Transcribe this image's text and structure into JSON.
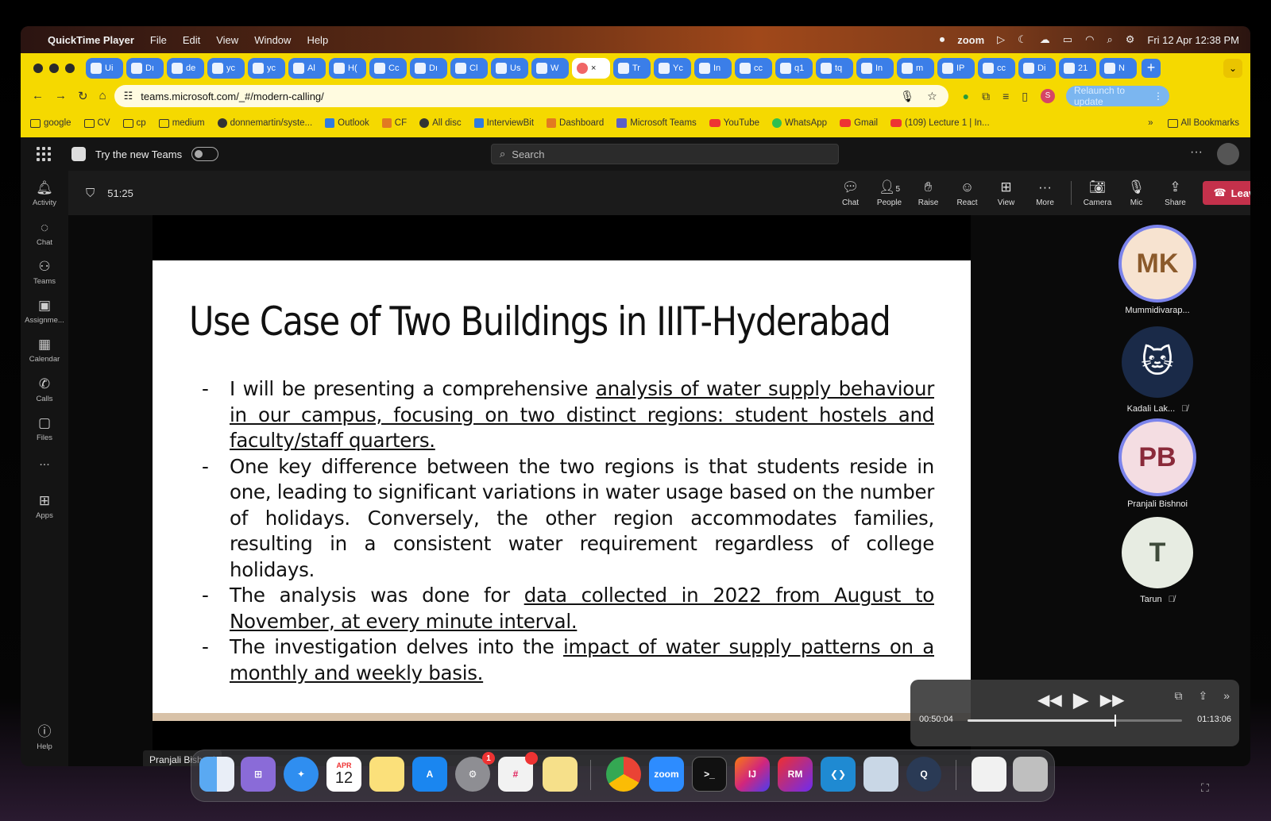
{
  "menubar": {
    "app": "QuickTime Player",
    "items": [
      "File",
      "Edit",
      "View",
      "Window",
      "Help"
    ],
    "zoom": "zoom",
    "datetime": "Fri 12 Apr 12:38 PM"
  },
  "browser": {
    "tabs": [
      "Ui",
      "Dı",
      "de",
      "yc",
      "yc",
      "Al",
      "H(",
      "Cc",
      "Dı",
      "Cl",
      "Us",
      "W",
      "",
      "Tr",
      "Yc",
      "In",
      "cc",
      "q1",
      "tq",
      "In",
      "m",
      "IP",
      "cc",
      "Di",
      "21",
      "N"
    ],
    "url": "teams.microsoft.com/_#/modern-calling/",
    "relaunch": "Relaunch to update",
    "profile_initial": "S",
    "bookmarks": [
      "google",
      "CV",
      "cp",
      "medium",
      "donnemartin/syste...",
      "Outlook",
      "CF",
      "All disc",
      "InterviewBit",
      "Dashboard",
      "Microsoft Teams",
      "YouTube",
      "WhatsApp",
      "Gmail",
      "(109) Lecture 1 | In..."
    ],
    "all_bookmarks": "All Bookmarks",
    "more": "»"
  },
  "teams": {
    "try_new": "Try the new Teams",
    "search_placeholder": "Search",
    "rail": [
      "Activity",
      "Chat",
      "Teams",
      "Assignme...",
      "Calendar",
      "Calls",
      "Files",
      "...",
      "Apps",
      "Help"
    ],
    "timer": "51:25",
    "toolbar": {
      "chat": "Chat",
      "people": "People",
      "people_count": "5",
      "raise": "Raise",
      "react": "React",
      "view": "View",
      "more": "More",
      "camera": "Camera",
      "mic": "Mic",
      "share": "Share",
      "leave": "Leave"
    },
    "speaker_tag": "Pranjali Bishnoi",
    "participants": [
      {
        "initials": "MK",
        "name": "Mummidivarap...",
        "color": "#f7e3d0",
        "text": "#8b5a2b"
      },
      {
        "initials": "",
        "name": "Kadali Lak...",
        "color": "#1a2a48",
        "text": "#fff"
      },
      {
        "initials": "PB",
        "name": "Pranjali Bishnoi",
        "color": "#f4dde2",
        "text": "#8a2a3a"
      },
      {
        "initials": "T",
        "name": "Tarun",
        "color": "#e7ece2",
        "text": "#3e4a3a"
      }
    ]
  },
  "slide": {
    "title": "Use Case of Two Buildings in IIIT-Hyderabad",
    "bullets": [
      {
        "plain": "I will be presenting a comprehensive ",
        "underline": "analysis of water supply behaviour in our campus, focusing on two distinct regions: student hostels and faculty/staff quarters.",
        "after": ""
      },
      {
        "plain": "One key difference between the two regions is that students reside in one, leading to significant variations in water usage based on the number of holidays. Conversely, the other region accommodates families, resulting in a consistent water requirement regardless of college holidays.",
        "underline": "",
        "after": ""
      },
      {
        "plain": "The analysis was done for ",
        "underline": "data collected in 2022 from August to November, at every minute interval.",
        "after": ""
      },
      {
        "plain": "The investigation delves into the ",
        "underline": "impact of water supply patterns on a monthly and weekly basis.",
        "after": ""
      }
    ]
  },
  "player": {
    "current": "00:50:04",
    "total": "01:13:06",
    "progress": 0.685
  },
  "dock": {
    "calendar_month": "APR",
    "calendar_day": "12",
    "zoom_label": "zoom",
    "ij_label": "IJ",
    "rm_label": "RM",
    "settings_badge": "1"
  }
}
